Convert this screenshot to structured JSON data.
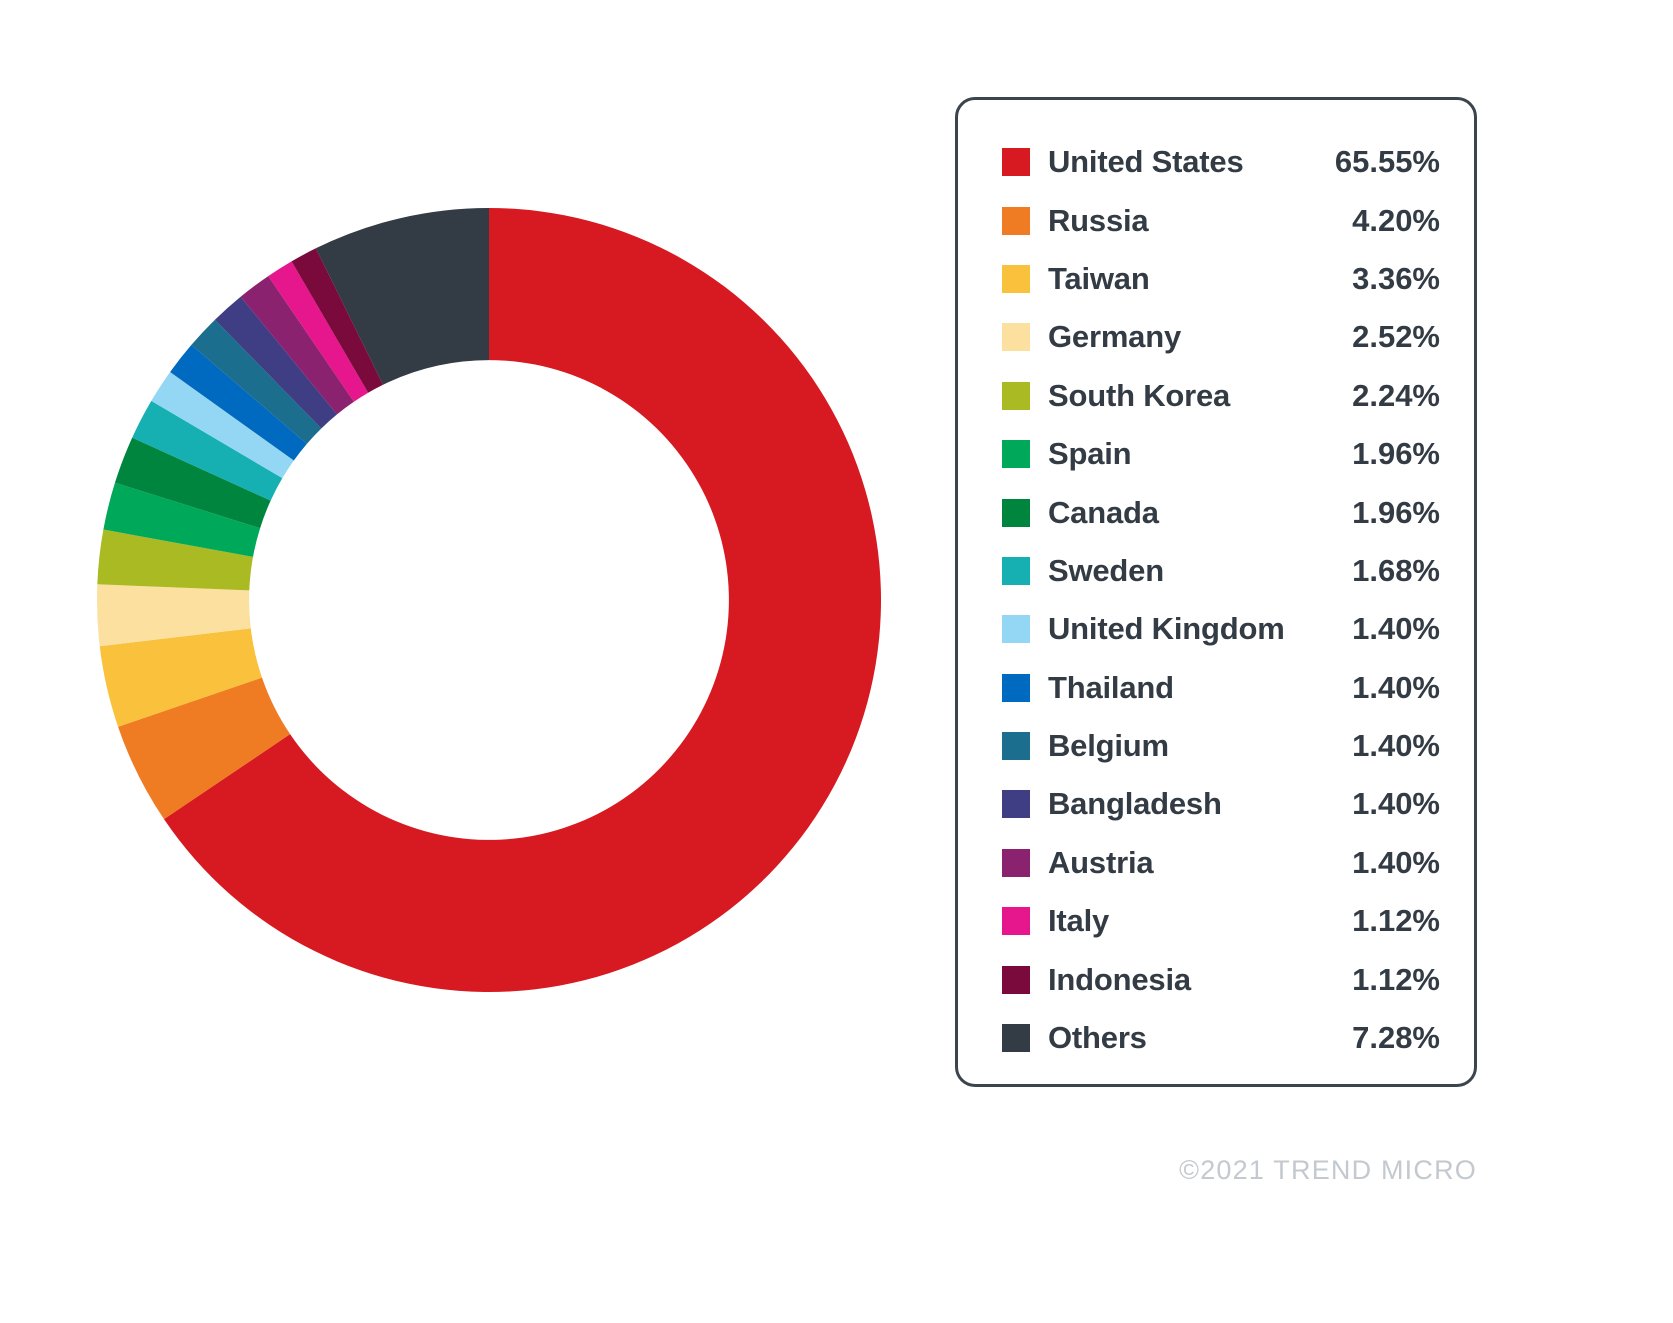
{
  "chart_data": {
    "type": "pie",
    "variant": "donut",
    "title": "",
    "subtitle": "",
    "xlabel": "",
    "ylabel": "",
    "unit": "%",
    "start_angle_deg": 0,
    "direction": "clockwise",
    "inner_radius_ratio": 0.612,
    "legend_position": "right",
    "grid": false,
    "categories": [
      "United States",
      "Russia",
      "Taiwan",
      "Germany",
      "South Korea",
      "Spain",
      "Canada",
      "Sweden",
      "United Kingdom",
      "Thailand",
      "Belgium",
      "Bangladesh",
      "Austria",
      "Italy",
      "Indonesia",
      "Others"
    ],
    "values": [
      65.55,
      4.2,
      3.36,
      2.52,
      2.24,
      1.96,
      1.96,
      1.68,
      1.4,
      1.4,
      1.4,
      1.4,
      1.4,
      1.12,
      1.12,
      7.28
    ],
    "value_labels": [
      "65.55%",
      "4.20%",
      "3.36%",
      "2.52%",
      "2.24%",
      "1.96%",
      "1.96%",
      "1.68%",
      "1.40%",
      "1.40%",
      "1.40%",
      "1.40%",
      "1.40%",
      "1.12%",
      "1.12%",
      "7.28%"
    ],
    "colors": [
      "#d71921",
      "#ef7b23",
      "#f9c13c",
      "#fbe0a0",
      "#aaba22",
      "#00a85a",
      "#00853f",
      "#16b0b3",
      "#94d7f4",
      "#0069c0",
      "#1b6e8e",
      "#3f3e84",
      "#8a2270",
      "#e6168c",
      "#7b0a3c",
      "#333b45"
    ]
  },
  "legend": {
    "items": [
      {
        "label": "United States",
        "value": "65.55%",
        "color": "#d71921"
      },
      {
        "label": "Russia",
        "value": "4.20%",
        "color": "#ef7b23"
      },
      {
        "label": "Taiwan",
        "value": "3.36%",
        "color": "#f9c13c"
      },
      {
        "label": "Germany",
        "value": "2.52%",
        "color": "#fbe0a0"
      },
      {
        "label": "South Korea",
        "value": "2.24%",
        "color": "#aaba22"
      },
      {
        "label": "Spain",
        "value": "1.96%",
        "color": "#00a85a"
      },
      {
        "label": "Canada",
        "value": "1.96%",
        "color": "#00853f"
      },
      {
        "label": "Sweden",
        "value": "1.68%",
        "color": "#16b0b3"
      },
      {
        "label": "United Kingdom",
        "value": "1.40%",
        "color": "#94d7f4"
      },
      {
        "label": "Thailand",
        "value": "1.40%",
        "color": "#0069c0"
      },
      {
        "label": "Belgium",
        "value": "1.40%",
        "color": "#1b6e8e"
      },
      {
        "label": "Bangladesh",
        "value": "1.40%",
        "color": "#3f3e84"
      },
      {
        "label": "Austria",
        "value": "1.40%",
        "color": "#8a2270"
      },
      {
        "label": "Italy",
        "value": "1.12%",
        "color": "#e6168c"
      },
      {
        "label": "Indonesia",
        "value": "1.12%",
        "color": "#7b0a3c"
      },
      {
        "label": "Others",
        "value": "7.28%",
        "color": "#333b45"
      }
    ],
    "border_color": "#3c444e"
  },
  "footer": {
    "copyright": "©2021 TREND MICRO",
    "color": "#c3c9cf"
  }
}
